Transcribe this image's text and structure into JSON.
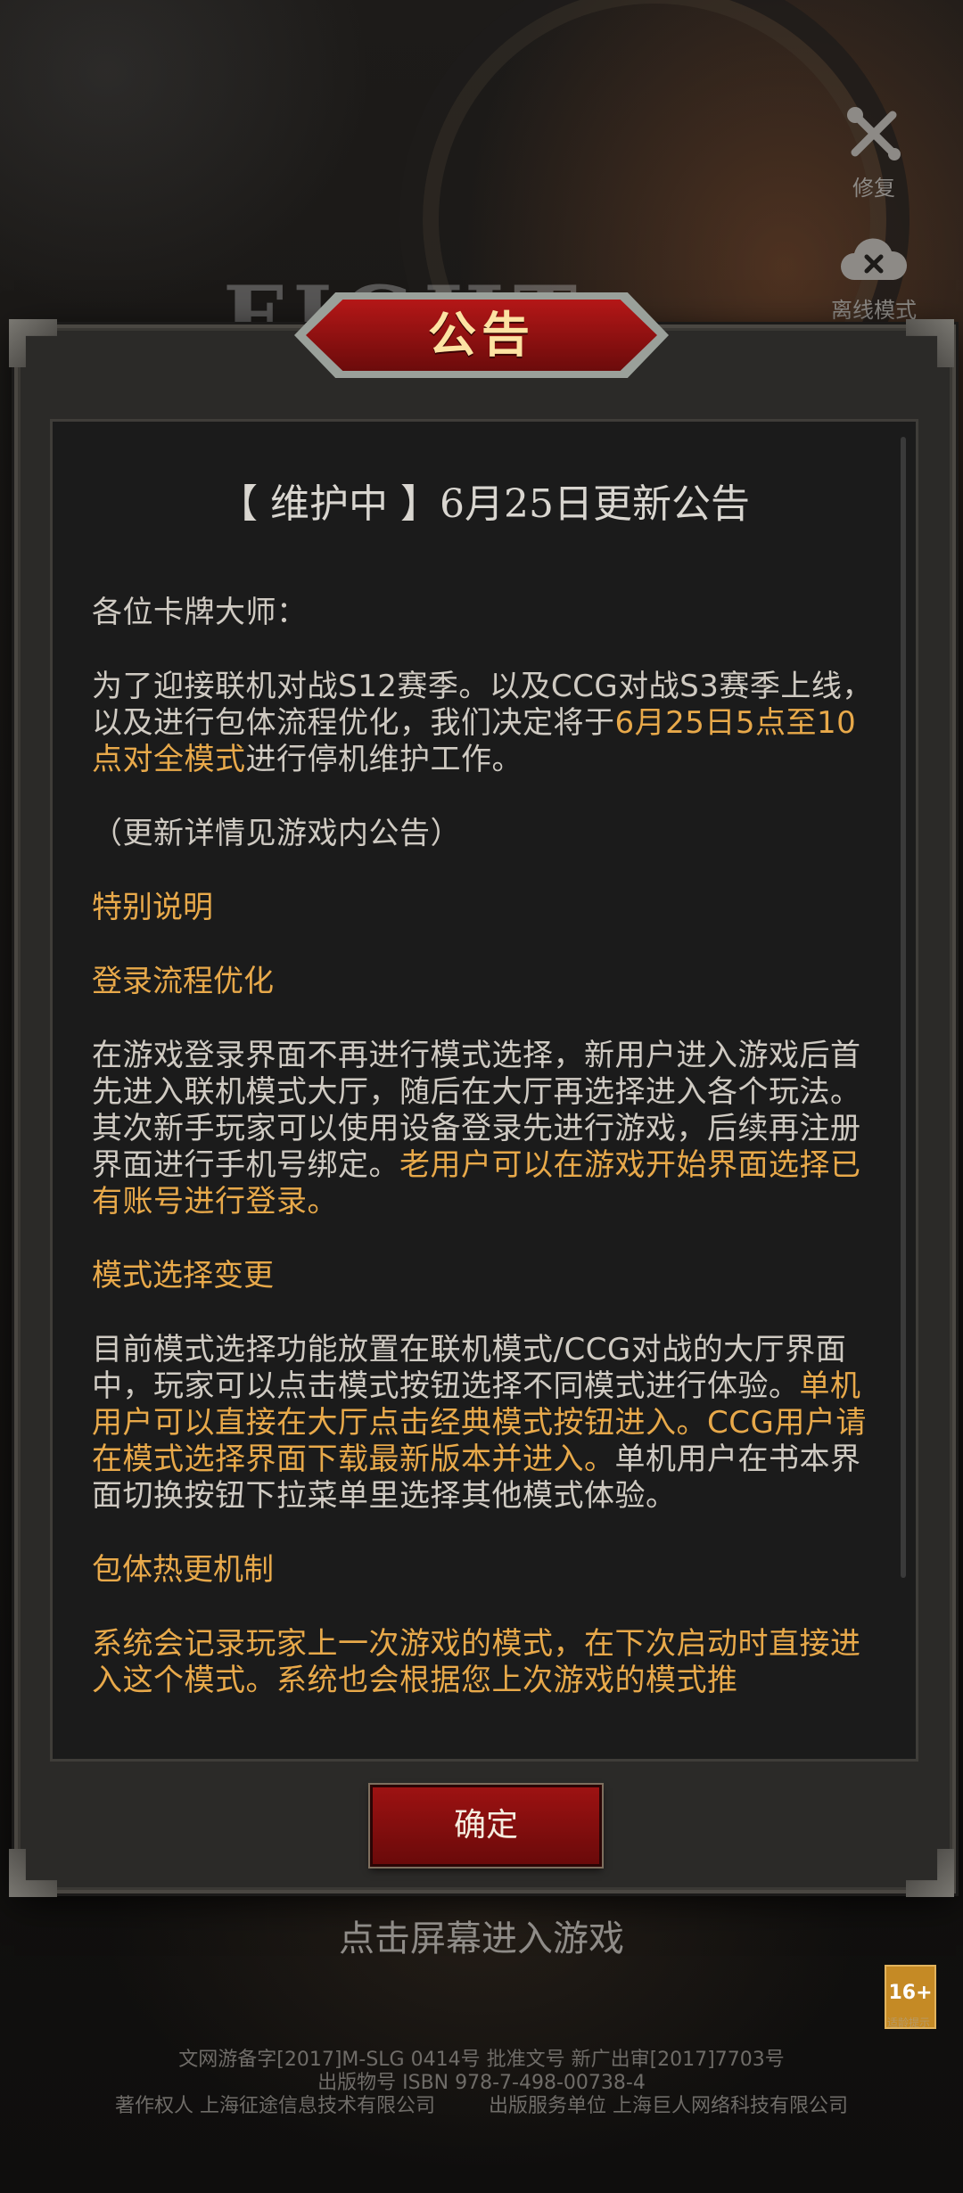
{
  "utilities": {
    "repair_label": "修复",
    "offline_label": "离线模式"
  },
  "dialog": {
    "title": "公告",
    "headline": "【 维护中 】6月25日更新公告",
    "greeting": "各位卡牌大师：",
    "para1": {
      "normal_1": "为了迎接联机对战S12赛季。以及CCG对战S3赛季上线，以及进行包体流程优化，我们决定将于",
      "highlight": "6月25日5点至10点对全模式",
      "normal_2": "进行停机维护工作。"
    },
    "para2": "（更新详情见游戏内公告）",
    "section_special": "特别说明",
    "section_login": "登录流程优化",
    "para3": {
      "normal": "在游戏登录界面不再进行模式选择，新用户进入游戏后首先进入联机模式大厅，随后在大厅再选择进入各个玩法。其次新手玩家可以使用设备登录先进行游戏，后续再注册界面进行手机号绑定。",
      "highlight": "老用户可以在游戏开始界面选择已有账号进行登录。"
    },
    "section_mode": "模式选择变更",
    "para4": {
      "normal_1": "目前模式选择功能放置在联机模式/CCG对战的大厅界面中，玩家可以点击模式按钮选择不同模式进行体验。",
      "highlight": "单机用户可以直接在大厅点击经典模式按钮进入。CCG用户请在模式选择界面下载最新版本并进入。",
      "normal_2": "单机用户在书本界面切换按钮下拉菜单里选择其他模式体验。"
    },
    "section_hotfix": "包体热更机制",
    "para5": {
      "highlight": "系统会记录玩家上一次游戏的模式，在下次启动时直接进入这个模式。系统也会根据您上次游戏的模式推"
    },
    "confirm_label": "确定"
  },
  "tap_hint": "点击屏幕进入游戏",
  "age_rating": {
    "badge": "16+",
    "label": "适龄提示"
  },
  "footer": {
    "line1": "文网游备字[2017]M-SLG 0414号 批准文号 新广出审[2017]7703号",
    "line2": "出版物号 ISBN 978-7-498-00738-4",
    "line3_left": "著作权人 上海征途信息技术有限公司",
    "line3_right": "出版服务单位 上海巨人网络科技有限公司"
  },
  "colors": {
    "accent": "#e8a94a",
    "title_text": "#fde3a3",
    "button_red": "#8a0f0f"
  }
}
